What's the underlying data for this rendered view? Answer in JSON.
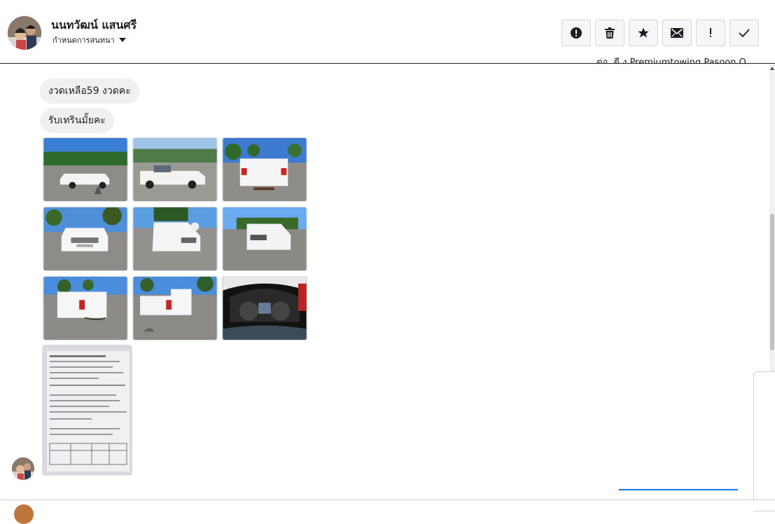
{
  "contact": {
    "name": "นนทวัฒน์ แสนศรี",
    "manage_label": "กำหนดการสนทนา"
  },
  "toolbar": {
    "buttons": [
      {
        "name": "alert-button",
        "icon": "exclamation-circle-icon"
      },
      {
        "name": "delete-button",
        "icon": "trash-icon"
      },
      {
        "name": "star-button",
        "icon": "star-icon"
      },
      {
        "name": "mark-unread-button",
        "icon": "envelope-icon"
      },
      {
        "name": "spam-button",
        "icon": "exclamation-icon"
      },
      {
        "name": "done-button",
        "icon": "check-icon"
      }
    ]
  },
  "thread": {
    "partial_top_text": "ต่อ..ดี ง Premiumtowing Pasoon O",
    "messages": [
      {
        "text": "งวดเหลือ59 งวดคะ"
      },
      {
        "text": "รับเทรินมั้ยคะ"
      }
    ],
    "photos": [
      {
        "label": "truck-side-left"
      },
      {
        "label": "truck-front-three-quarter"
      },
      {
        "label": "truck-rear"
      },
      {
        "label": "truck-front"
      },
      {
        "label": "truck-front-right"
      },
      {
        "label": "truck-front-right-2"
      },
      {
        "label": "truck-rear-left"
      },
      {
        "label": "truck-rear-left-2"
      },
      {
        "label": "dashboard-gauges"
      }
    ],
    "document_photo": {
      "label": "vehicle-registration-document"
    }
  },
  "colors": {
    "accent": "#1877f2",
    "bubble": "#f0f0f0",
    "button_bg": "#f5f6f7"
  }
}
